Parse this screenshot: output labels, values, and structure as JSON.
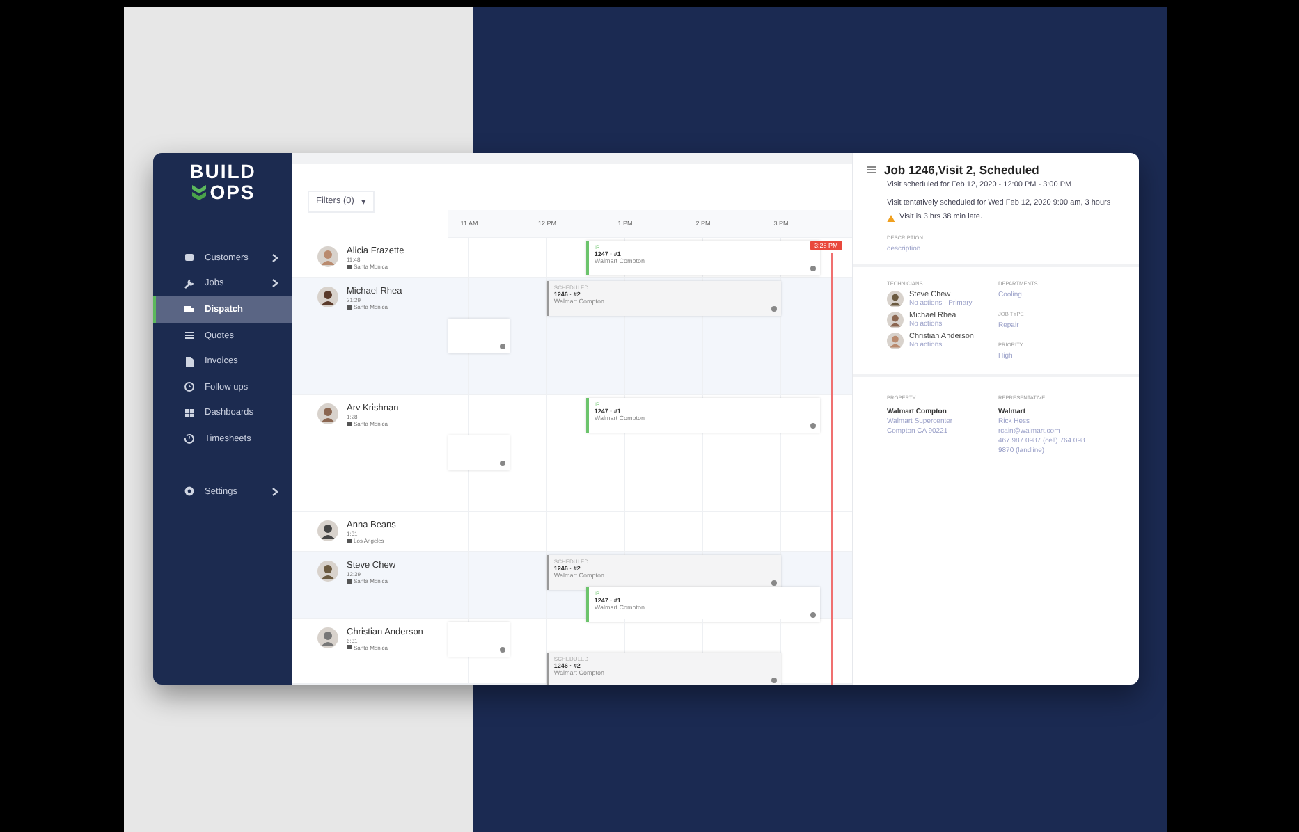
{
  "logo": {
    "line_1": "BUILD",
    "line_2": "OPS"
  },
  "sidebar": {
    "items": [
      {
        "label": "Customers",
        "selected": false,
        "submenu": true
      },
      {
        "label": "Jobs",
        "selected": false,
        "submenu": true
      },
      {
        "label": "Dispatch",
        "selected": true,
        "submenu": false
      },
      {
        "label": "Quotes",
        "selected": false,
        "submenu": false
      },
      {
        "label": "Invoices",
        "selected": false,
        "submenu": false
      },
      {
        "label": "Follow ups",
        "selected": false,
        "submenu": false
      },
      {
        "label": "Dashboards",
        "selected": false,
        "submenu": false
      },
      {
        "label": "Timesheets",
        "selected": false,
        "submenu": false
      }
    ],
    "settings": {
      "label": "Settings",
      "submenu": true
    }
  },
  "filters": {
    "label": "Filters (0)",
    "caret": "▾"
  },
  "timeline": {
    "hours": [
      "11 AM",
      "12 PM",
      "1 PM",
      "2 PM",
      "3 PM"
    ],
    "now": "3:28 PM",
    "rows": [
      {
        "name": "Alicia Frazette",
        "time": "11:48",
        "location": "Santa Monica",
        "selected": false,
        "expanded": false,
        "events": [
          {
            "kind": "in-progress",
            "status": "IP",
            "job": "1247 · #1",
            "place": "Walmart Compton"
          }
        ]
      },
      {
        "name": "Michael Rhea",
        "time": "21:29",
        "location": "Santa Monica",
        "selected": true,
        "expanded": true,
        "events": [
          {
            "kind": "scheduled",
            "status": "SCHEDULED",
            "job": "1246 · #2",
            "place": "Walmart Compton"
          },
          {
            "kind": "overflow"
          }
        ]
      },
      {
        "name": "Arv Krishnan",
        "time": "1:28",
        "location": "Santa Monica",
        "selected": false,
        "expanded": true,
        "events": [
          {
            "kind": "in-progress",
            "status": "IP",
            "job": "1247 · #1",
            "place": "Walmart Compton"
          },
          {
            "kind": "overflow"
          }
        ]
      },
      {
        "name": "Anna Beans",
        "time": "1:31",
        "location": "Los Angeles",
        "selected": false,
        "expanded": false,
        "events": []
      },
      {
        "name": "Steve Chew",
        "time": "12:39",
        "location": "Santa Monica",
        "selected": true,
        "expanded": false,
        "events": [
          {
            "kind": "scheduled",
            "status": "SCHEDULED",
            "job": "1246 · #2",
            "place": "Walmart Compton"
          },
          {
            "kind": "in-progress",
            "status": "IP",
            "job": "1247 · #1",
            "place": "Walmart Compton"
          }
        ]
      },
      {
        "name": "Christian Anderson",
        "time": "6:31",
        "location": "Santa Monica",
        "selected": false,
        "expanded": false,
        "events": [
          {
            "kind": "overflow"
          },
          {
            "kind": "scheduled",
            "status": "SCHEDULED",
            "job": "1246 · #2",
            "place": "Walmart Compton"
          }
        ]
      }
    ]
  },
  "detail": {
    "title": "Job 1246,Visit 2, Scheduled",
    "scheduled": "Visit scheduled for Feb 12, 2020 - 12:00 PM - 3:00 PM",
    "tentative": "Visit tentatively scheduled for Wed Feb 12, 2020 9:00 am, 3 hours",
    "warning": "Visit is 3 hrs 38 min late.",
    "description_label": "DESCRIPTION",
    "description": "description",
    "technicians_label": "TECHNICIANS",
    "technicians": [
      {
        "name": "Steve Chew",
        "note": "No actions · Primary"
      },
      {
        "name": "Michael Rhea",
        "note": "No actions"
      },
      {
        "name": "Christian Anderson",
        "note": "No actions"
      }
    ],
    "fields": [
      {
        "label": "DEPARTMENTS",
        "value": "Cooling"
      },
      {
        "label": "JOB TYPE",
        "value": "Repair"
      },
      {
        "label": "PRIORITY",
        "value": "High"
      }
    ],
    "property": {
      "label": "PROPERTY",
      "name": "Walmart Compton",
      "lines": [
        "Walmart Supercenter",
        "Compton CA 90221"
      ]
    },
    "representative": {
      "label": "REPRESENTATIVE",
      "name": "Walmart",
      "lines": [
        "Rick Hess",
        "rcain@walmart.com",
        "467 987 0987 (cell) 764 098",
        "9870 (landline)"
      ]
    }
  }
}
